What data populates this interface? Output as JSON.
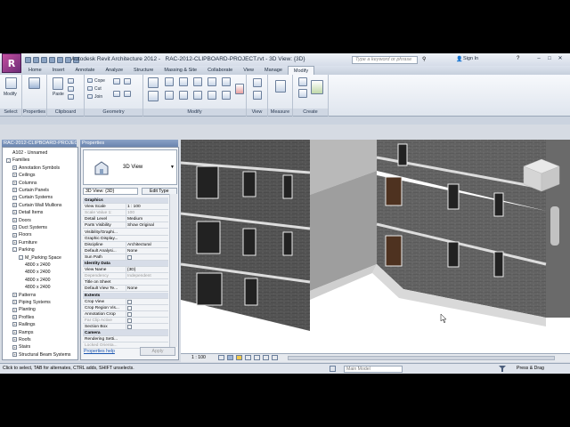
{
  "window": {
    "app_title": "Autodesk Revit Architecture 2012 -",
    "document_title": "RAC-2012-CLIPBOARD-PROJECT.rvt - 3D View: {3D}",
    "search_placeholder": "Type a keyword or phrase",
    "signin_label": "Sign In",
    "logo_letter": "R"
  },
  "tabs": [
    "Home",
    "Insert",
    "Annotate",
    "Analyze",
    "Structure",
    "Massing & Site",
    "Collaborate",
    "View",
    "Manage",
    "Modify"
  ],
  "active_tab": "Modify",
  "ribbon": {
    "modify_label": "Modify",
    "properties_label": "Properties",
    "paste_label": "Paste",
    "cope_label": "Cope",
    "cut_label": "Cut",
    "join_label": "Join",
    "panels": [
      "Select",
      "Properties",
      "Clipboard",
      "Geometry",
      "Modify",
      "View",
      "Measure",
      "Create"
    ]
  },
  "browser": {
    "title": "RAC-2012-CLIPBOARD-PROJECT",
    "items": [
      {
        "label": "A102 - Unnamed",
        "indent": 1,
        "toggle": ""
      },
      {
        "label": "Families",
        "indent": 0,
        "toggle": "-"
      },
      {
        "label": "Annotation Symbols",
        "indent": 1,
        "toggle": "+"
      },
      {
        "label": "Ceilings",
        "indent": 1,
        "toggle": "+"
      },
      {
        "label": "Columns",
        "indent": 1,
        "toggle": "+"
      },
      {
        "label": "Curtain Panels",
        "indent": 1,
        "toggle": "+"
      },
      {
        "label": "Curtain Systems",
        "indent": 1,
        "toggle": "+"
      },
      {
        "label": "Curtain Wall Mullions",
        "indent": 1,
        "toggle": "+"
      },
      {
        "label": "Detail Items",
        "indent": 1,
        "toggle": "+"
      },
      {
        "label": "Doors",
        "indent": 1,
        "toggle": "+"
      },
      {
        "label": "Duct Systems",
        "indent": 1,
        "toggle": "+"
      },
      {
        "label": "Floors",
        "indent": 1,
        "toggle": "+"
      },
      {
        "label": "Furniture",
        "indent": 1,
        "toggle": "+"
      },
      {
        "label": "Parking",
        "indent": 1,
        "toggle": "-"
      },
      {
        "label": "M_Parking Space",
        "indent": 2,
        "toggle": "-"
      },
      {
        "label": "4800 x 2400",
        "indent": 3,
        "toggle": ""
      },
      {
        "label": "4800 x 2400",
        "indent": 3,
        "toggle": ""
      },
      {
        "label": "4800 x 2400",
        "indent": 3,
        "toggle": ""
      },
      {
        "label": "4800 x 2400",
        "indent": 3,
        "toggle": ""
      },
      {
        "label": "Patterns",
        "indent": 1,
        "toggle": "+"
      },
      {
        "label": "Piping Systems",
        "indent": 1,
        "toggle": "+"
      },
      {
        "label": "Planting",
        "indent": 1,
        "toggle": "+"
      },
      {
        "label": "Profiles",
        "indent": 1,
        "toggle": "+"
      },
      {
        "label": "Railings",
        "indent": 1,
        "toggle": "+"
      },
      {
        "label": "Ramps",
        "indent": 1,
        "toggle": "+"
      },
      {
        "label": "Roofs",
        "indent": 1,
        "toggle": "+"
      },
      {
        "label": "Stairs",
        "indent": 1,
        "toggle": "+"
      },
      {
        "label": "Structural Beam Systems",
        "indent": 1,
        "toggle": "+"
      }
    ]
  },
  "properties": {
    "title": "Properties",
    "type_name": "3D View",
    "view_selector": "3D View: {3D}",
    "edit_type": "Edit Type",
    "rows": [
      {
        "key": "Graphics",
        "val": "",
        "kind": "section"
      },
      {
        "key": "View Scale",
        "val": "1 : 100",
        "kind": "row"
      },
      {
        "key": "Scale Value  1:",
        "val": "100",
        "kind": "grey"
      },
      {
        "key": "Detail Level",
        "val": "Medium",
        "kind": "row"
      },
      {
        "key": "Parts Visibility",
        "val": "Show Original",
        "kind": "row"
      },
      {
        "key": "Visibility/Graphi...",
        "val": "Edit...",
        "kind": "button"
      },
      {
        "key": "Graphic Display...",
        "val": "Edit...",
        "kind": "button"
      },
      {
        "key": "Discipline",
        "val": "Architectural",
        "kind": "row"
      },
      {
        "key": "Default Analysi...",
        "val": "None",
        "kind": "row"
      },
      {
        "key": "Sun Path",
        "val": "",
        "kind": "check"
      },
      {
        "key": "Identity Data",
        "val": "",
        "kind": "section"
      },
      {
        "key": "View Name",
        "val": "{3D}",
        "kind": "row"
      },
      {
        "key": "Dependency",
        "val": "Independent",
        "kind": "grey"
      },
      {
        "key": "Title on Sheet",
        "val": "",
        "kind": "row"
      },
      {
        "key": "Default View Te...",
        "val": "None",
        "kind": "row"
      },
      {
        "key": "Extents",
        "val": "",
        "kind": "section"
      },
      {
        "key": "Crop View",
        "val": "",
        "kind": "check"
      },
      {
        "key": "Crop Region Vis...",
        "val": "",
        "kind": "check"
      },
      {
        "key": "Annotation Crop",
        "val": "",
        "kind": "check"
      },
      {
        "key": "Far Clip Active",
        "val": "",
        "kind": "greycheck"
      },
      {
        "key": "Section Box",
        "val": "",
        "kind": "check"
      },
      {
        "key": "Camera",
        "val": "",
        "kind": "section"
      },
      {
        "key": "Rendering Setti...",
        "val": "Edit...",
        "kind": "button"
      },
      {
        "key": "Locked Orienta...",
        "val": "",
        "kind": "grey"
      }
    ],
    "help": "Properties help",
    "apply": "Apply"
  },
  "viewcontrol": {
    "scale": "1 : 100"
  },
  "status": {
    "message": "Click to select, TAB for alternates, CTRL adds, SHIFT unselects.",
    "model": "Main Model",
    "press_drag": "Press & Drag"
  }
}
